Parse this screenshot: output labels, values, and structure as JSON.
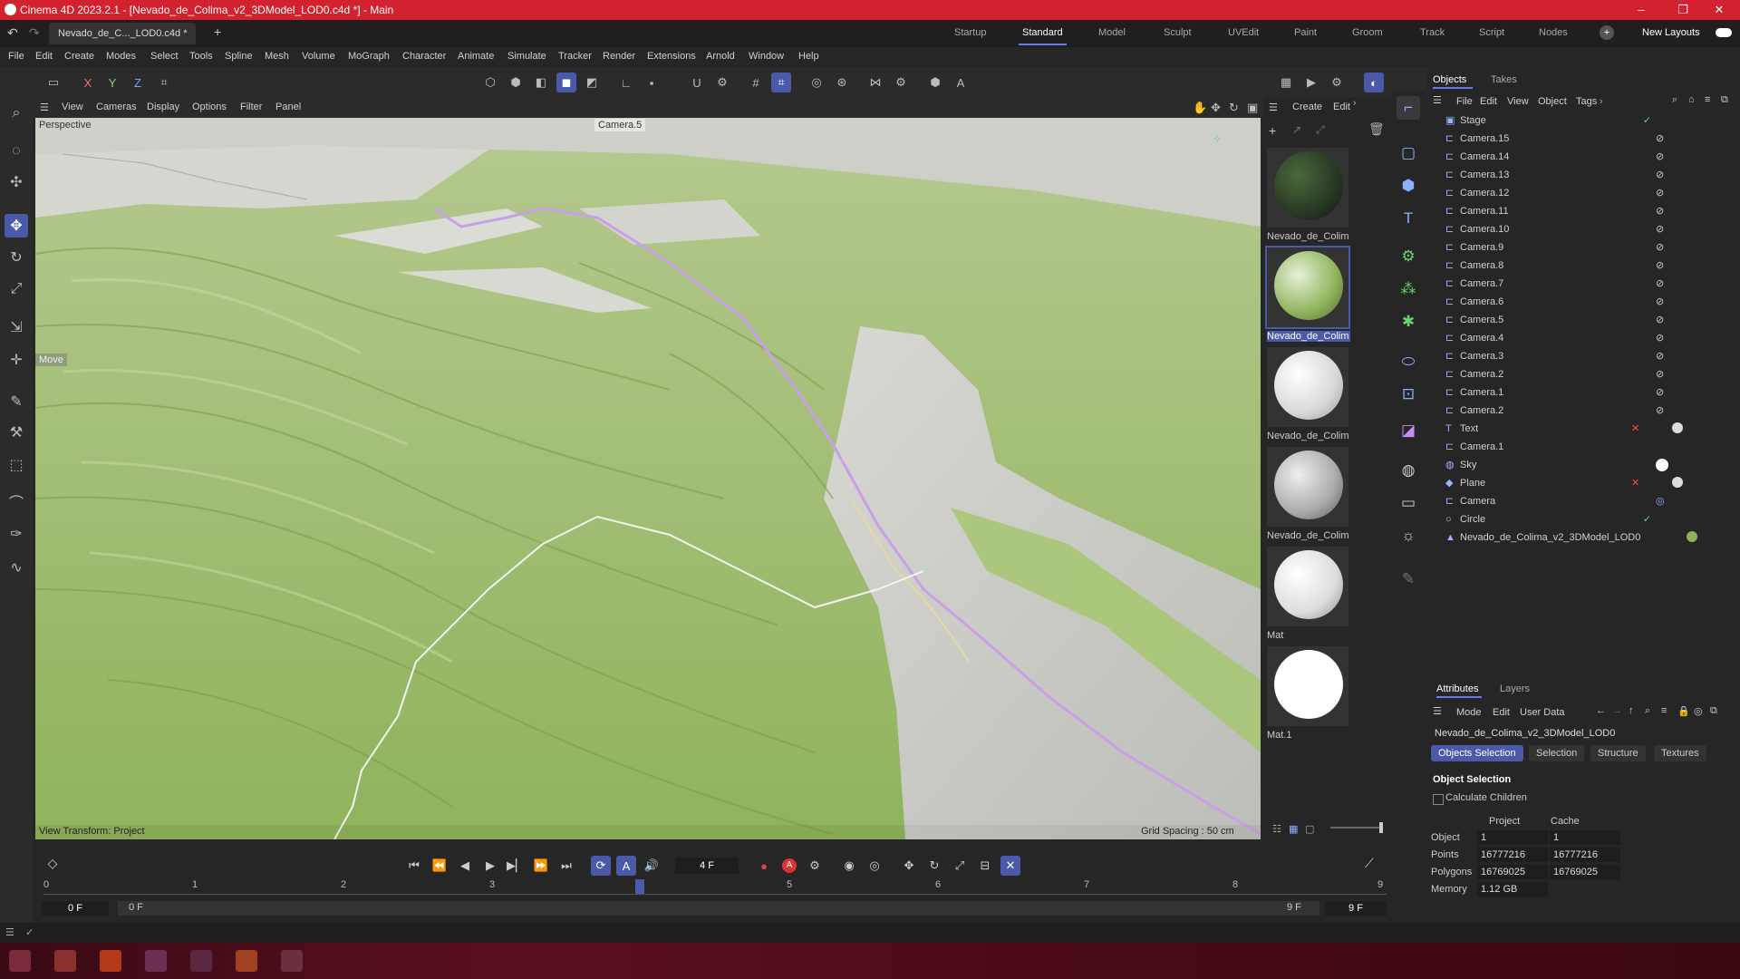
{
  "window": {
    "title": "Cinema 4D 2023.2.1 - [Nevado_de_Colima_v2_3DModel_LOD0.c4d *] - Main",
    "file_tab": "Nevado_de_C..._LOD0.c4d *",
    "add_tab": "+"
  },
  "layouts": [
    "Startup",
    "Standard",
    "Model",
    "Sculpt",
    "UVEdit",
    "Paint",
    "Groom",
    "Track",
    "Script",
    "Nodes"
  ],
  "layouts_active": "Standard",
  "new_layouts": "New Layouts",
  "menu": [
    "File",
    "Edit",
    "Create",
    "Modes",
    "Select",
    "Tools",
    "Spline",
    "Mesh",
    "Volume",
    "MoGraph",
    "Character",
    "Animate",
    "Simulate",
    "Tracker",
    "Render",
    "Extensions",
    "Arnold",
    "Window",
    "Help"
  ],
  "axis_lock": {
    "x": "X",
    "y": "Y",
    "z": "Z"
  },
  "viewport": {
    "menu": [
      "View",
      "Cameras",
      "Display",
      "Options",
      "Filter",
      "Panel"
    ],
    "name": "Perspective",
    "camera": "Camera.5",
    "move_label": "Move",
    "view_transform": "View Transform: Project",
    "grid_spacing": "Grid Spacing : 50 cm"
  },
  "materials": {
    "menu": [
      "Create",
      "Edit"
    ],
    "items": [
      {
        "name": "Nevado_de_Colim",
        "selected": false
      },
      {
        "name": "Nevado_de_Colim",
        "selected": true
      },
      {
        "name": "Nevado_de_Colim",
        "selected": false
      },
      {
        "name": "Nevado_de_Colim",
        "selected": false
      },
      {
        "name": "Mat",
        "selected": false
      },
      {
        "name": "Mat.1",
        "selected": false
      }
    ]
  },
  "objects": {
    "tabs": [
      "Objects",
      "Takes"
    ],
    "menu": [
      "File",
      "Edit",
      "View",
      "Object",
      "Tags"
    ],
    "rows": [
      "Stage",
      "Camera.15",
      "Camera.14",
      "Camera.13",
      "Camera.12",
      "Camera.11",
      "Camera.10",
      "Camera.9",
      "Camera.8",
      "Camera.7",
      "Camera.6",
      "Camera.5",
      "Camera.4",
      "Camera.3",
      "Camera.2",
      "Camera.1",
      "Camera.2",
      "Text",
      "Camera.1",
      "Sky",
      "Plane",
      "Camera",
      "Circle",
      "Nevado_de_Colima_v2_3DModel_LOD0"
    ]
  },
  "attributes": {
    "tabs": [
      "Attributes",
      "Layers"
    ],
    "menu": [
      "Mode",
      "Edit",
      "User Data"
    ],
    "object_name": "Nevado_de_Colima_v2_3DModel_LOD0",
    "subtabs": [
      "Objects Selection",
      "Selection",
      "Structure",
      "Textures"
    ],
    "section": "Object Selection",
    "calc_children": "Calculate Children",
    "col_project": "Project",
    "col_cache": "Cache",
    "stats": [
      {
        "label": "Object",
        "project": "1",
        "cache": "1"
      },
      {
        "label": "Points",
        "project": "16777216",
        "cache": "16777216"
      },
      {
        "label": "Polygons",
        "project": "16769025",
        "cache": "16769025"
      },
      {
        "label": "Memory",
        "project": "1.12 GB",
        "cache": ""
      }
    ]
  },
  "timeline": {
    "current_frame": "4 F",
    "ruler": [
      "0",
      "1",
      "2",
      "3",
      "4",
      "5",
      "6",
      "7",
      "8",
      "9"
    ],
    "start": "0 F",
    "start2": "0 F",
    "end": "9 F",
    "end2": "9 F"
  },
  "colors": {
    "accent": "#4b5aa8",
    "titlebar": "#d3222f",
    "terrain_green": "#9fc16a"
  }
}
